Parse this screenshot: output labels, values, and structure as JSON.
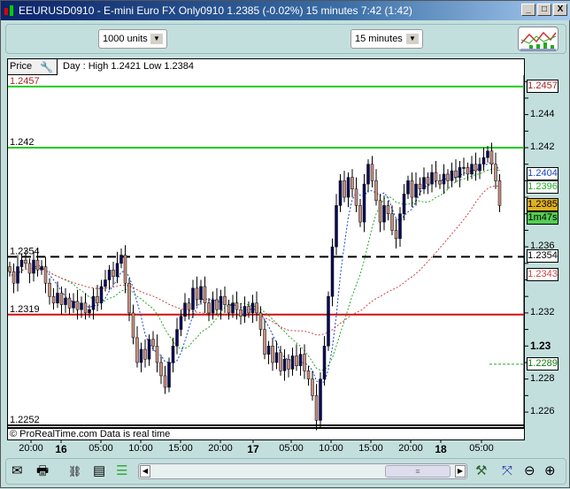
{
  "window": {
    "title": "EEURUSD0910 - E-mini Euro FX Only0910   1.2385 (-0.02%)   15 minutes  7:42 (1:42)",
    "minimize": "_",
    "maximize": "□",
    "close": "X"
  },
  "toolbar": {
    "units": "1000 units",
    "timeframe": "15 minutes",
    "indicators_icon": "indicators-icon"
  },
  "panel": {
    "tab": "Price",
    "day_info": "Day : High 1.2421 Low 1.2384",
    "footer": "© ProRealTime.com  Data is real time"
  },
  "colors": {
    "up": "#0a0a5a",
    "down": "#c89080",
    "green_line": "#22cc22",
    "red_line": "#cc1111",
    "ma_blue": "#1144cc",
    "ma_green": "#22aa22",
    "ma_red": "#cc4444"
  },
  "chart_data": {
    "type": "candlestick",
    "y_range": [
      1.225,
      1.2465
    ],
    "y_ticks": [
      "1.244",
      "1.242",
      "1.236",
      "1.232",
      "1.23",
      "1.228",
      "1.226"
    ],
    "x_ticks": [
      "20:00",
      "16",
      "05:00",
      "10:00",
      "15:00",
      "20:00",
      "17",
      "05:00",
      "10:00",
      "15:00",
      "20:00",
      "18",
      "05:00"
    ],
    "closes": [
      1.2345,
      1.2338,
      1.2348,
      1.2352,
      1.235,
      1.2344,
      1.2352,
      1.2346,
      1.2348,
      1.2338,
      1.233,
      1.2326,
      1.2332,
      1.2325,
      1.2329,
      1.2323,
      1.2327,
      1.2322,
      1.2326,
      1.232,
      1.2322,
      1.233,
      1.2326,
      1.2336,
      1.234,
      1.2346,
      1.2342,
      1.235,
      1.2355,
      1.2338,
      1.232,
      1.2305,
      1.229,
      1.2298,
      1.2292,
      1.2304,
      1.23,
      1.229,
      1.2282,
      1.2275,
      1.229,
      1.23,
      1.231,
      1.2318,
      1.2326,
      1.2322,
      1.2335,
      1.2328,
      1.2336,
      1.2326,
      1.232,
      1.2328,
      1.2322,
      1.233,
      1.2325,
      1.232,
      1.2326,
      1.2322,
      1.2318,
      1.2324,
      1.232,
      1.2326,
      1.232,
      1.231,
      1.2295,
      1.23,
      1.229,
      1.2296,
      1.2285,
      1.2292,
      1.2286,
      1.2294,
      1.2288,
      1.2295,
      1.2285,
      1.228,
      1.227,
      1.2255,
      1.228,
      1.23,
      1.233,
      1.236,
      1.2385,
      1.24,
      1.239,
      1.2402,
      1.2395,
      1.2385,
      1.2375,
      1.2398,
      1.241,
      1.24,
      1.2388,
      1.2375,
      1.2385,
      1.238,
      1.237,
      1.2365,
      1.238,
      1.2392,
      1.24,
      1.239,
      1.2398,
      1.2395,
      1.2402,
      1.2398,
      1.2405,
      1.24,
      1.2398,
      1.2404,
      1.24,
      1.2406,
      1.2402,
      1.2408,
      1.2408,
      1.2404,
      1.241,
      1.2406,
      1.241,
      1.2414,
      1.2418,
      1.241,
      1.24,
      1.2385
    ],
    "horizontal_lines": [
      {
        "value": 1.2457,
        "label": "1.2457",
        "style": "solid",
        "color": "#22cc22",
        "label_color": "#aa2222"
      },
      {
        "value": 1.242,
        "label": "1.242",
        "style": "solid",
        "color": "#22cc22",
        "label_color": "#000000"
      },
      {
        "value": 1.2354,
        "label": "1.2354",
        "style": "dashed",
        "color": "#000000",
        "label_color": "#000000"
      },
      {
        "value": 1.2319,
        "label": "1.2319",
        "style": "solid",
        "color": "#cc1111",
        "label_color": "#000000"
      },
      {
        "value": 1.2252,
        "label": "1.2252",
        "style": "solid",
        "color": "#000000",
        "label_color": "#000000"
      }
    ],
    "right_labels": [
      {
        "value": 1.2457,
        "text": "1.2457",
        "color": "#aa2222",
        "bg": "#ffffff"
      },
      {
        "value": 1.2404,
        "text": "1.2404",
        "color": "#1144cc",
        "bg": "#ffffff"
      },
      {
        "value": 1.2396,
        "text": "1.2396",
        "color": "#22aa22",
        "bg": "#ffffff"
      },
      {
        "value": 1.2385,
        "text": "1.2385",
        "color": "#000000",
        "bg": "#e0b020"
      },
      {
        "value": 1.2377,
        "text": "1m47s",
        "color": "#000000",
        "bg": "#55cc55"
      },
      {
        "value": 1.2354,
        "text": "1.2354",
        "color": "#000000",
        "bg": "#ffffff"
      },
      {
        "value": 1.2343,
        "text": "1.2343",
        "color": "#cc4444",
        "bg": "#ffffff"
      },
      {
        "value": 1.2289,
        "text": "1.2289",
        "color": "#117711",
        "bg": "#ffffff"
      }
    ],
    "projection_value": 1.2289
  }
}
